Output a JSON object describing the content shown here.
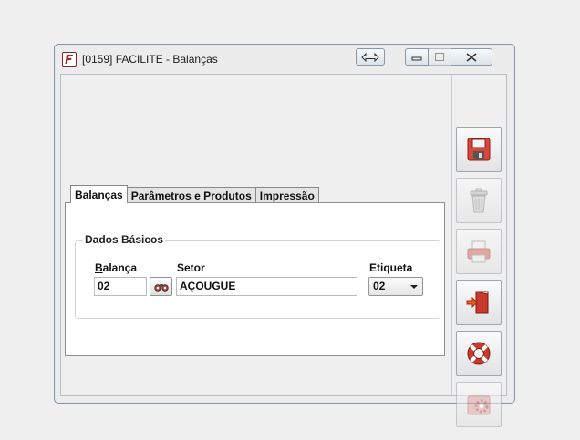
{
  "window": {
    "title": "[0159] FACILITE - Balanças"
  },
  "tabs": [
    {
      "label": "Balanças",
      "active": true
    },
    {
      "label": "Parâmetros e Produtos",
      "active": false
    },
    {
      "label": "Impressão",
      "active": false
    }
  ],
  "group": {
    "title": "Dados Básicos"
  },
  "fields": {
    "balanca": {
      "label_first": "B",
      "label_rest": "alança",
      "value": "02"
    },
    "setor": {
      "label": "Setor",
      "value": "AÇOUGUE"
    },
    "etiqueta": {
      "label": "Etiqueta",
      "value": "02"
    }
  },
  "side_buttons": [
    {
      "icon": "save-icon",
      "enabled": true
    },
    {
      "icon": "trash-icon",
      "enabled": false
    },
    {
      "icon": "printer-icon",
      "enabled": false
    },
    {
      "icon": "exit-door-icon",
      "enabled": true
    },
    {
      "icon": "help-lifebuoy-icon",
      "enabled": true
    },
    {
      "icon": "settings-gear-icon",
      "enabled": false
    }
  ],
  "colors": {
    "accent_red": "#c83a2e",
    "window_border": "#8a96a3"
  }
}
